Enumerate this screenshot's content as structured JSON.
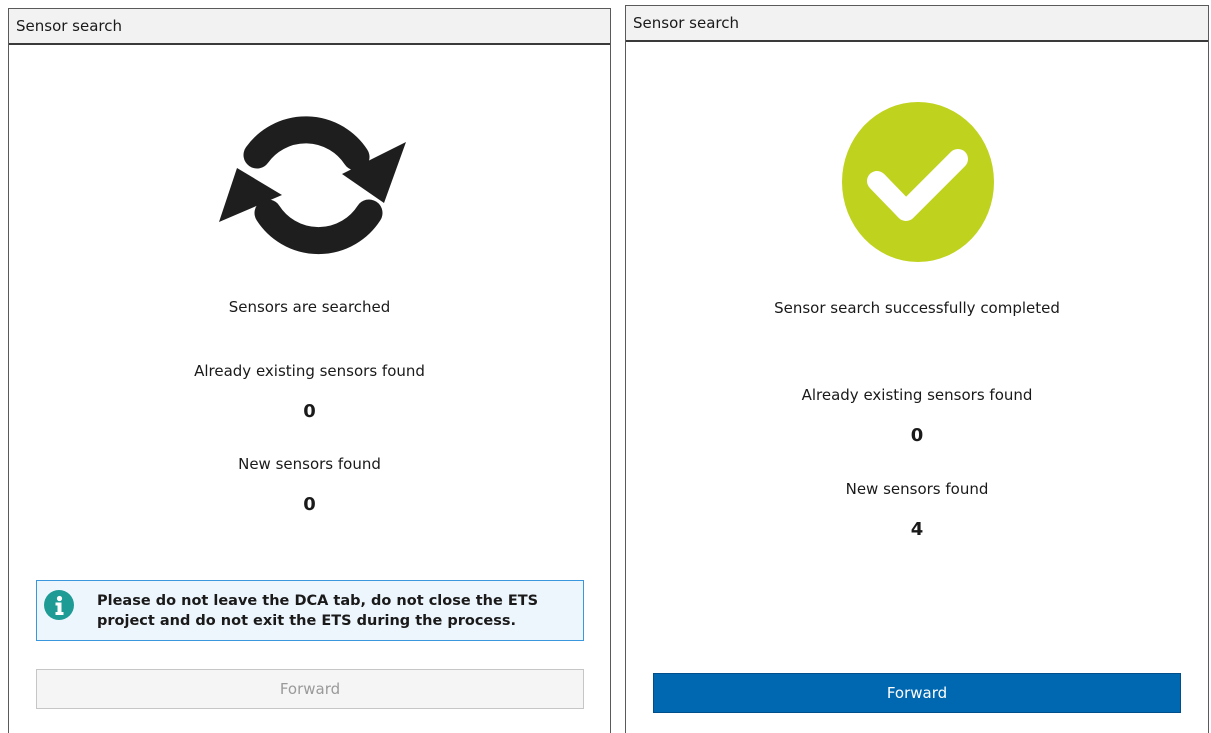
{
  "left_panel": {
    "title": "Sensor search",
    "status_icon": "refresh-icon",
    "status_text": "Sensors are searched",
    "existing_label": "Already existing sensors found",
    "existing_count": "0",
    "new_label": "New sensors found",
    "new_count": "0",
    "info_icon": "info-icon",
    "info_message": "Please do not leave the DCA tab, do not close the ETS project and do not exit the ETS during the process.",
    "forward_label": "Forward",
    "forward_enabled": false
  },
  "right_panel": {
    "title": "Sensor search",
    "status_icon": "checkmark-icon",
    "status_text": "Sensor search successfully completed",
    "existing_label": "Already existing sensors found",
    "existing_count": "0",
    "new_label": "New sensors found",
    "new_count": "4",
    "forward_label": "Forward",
    "forward_enabled": true
  },
  "colors": {
    "success": "#bfd21e",
    "primary_button": "#0067b1",
    "info_border": "#3a96dd",
    "info_background": "#eef6fd",
    "info_icon": "#1f9b96"
  }
}
